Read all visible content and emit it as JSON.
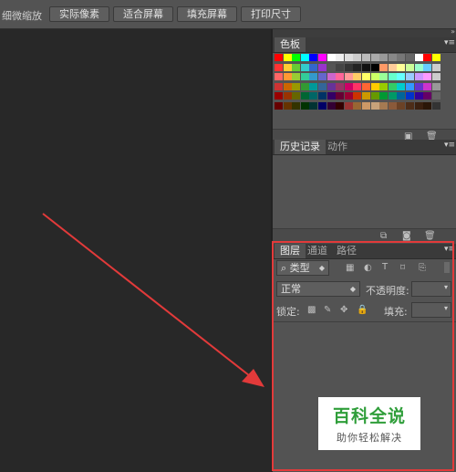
{
  "options_bar": {
    "scrubby_zoom_label": "细微缩放",
    "buttons": [
      "实际像素",
      "适合屏幕",
      "填充屏幕",
      "打印尺寸"
    ]
  },
  "swatches_panel": {
    "tab": "色板",
    "colors": [
      "#ff0000",
      "#ffff00",
      "#00ff00",
      "#00ffff",
      "#0000ff",
      "#ff00ff",
      "#ffffff",
      "#eeeeee",
      "#dddddd",
      "#cccccc",
      "#bbbbbb",
      "#aaaaaa",
      "#999999",
      "#888888",
      "#777777",
      "#666666",
      "#ffffff",
      "#ff0000",
      "#ffff00",
      "#ff3333",
      "#ffcc33",
      "#66cc33",
      "#33cccc",
      "#3366cc",
      "#9933cc",
      "#555555",
      "#444444",
      "#333333",
      "#222222",
      "#111111",
      "#000000",
      "#ff9966",
      "#ffcc99",
      "#ffff99",
      "#ccff99",
      "#99ffcc",
      "#66ccff",
      "#cccccc",
      "#ff6666",
      "#ff9933",
      "#99cc33",
      "#33cc99",
      "#3399cc",
      "#6666cc",
      "#cc66cc",
      "#ff6699",
      "#ff9999",
      "#ffcc66",
      "#ffff66",
      "#ccff66",
      "#99ff99",
      "#66ffcc",
      "#66ffff",
      "#99ccff",
      "#cc99ff",
      "#ff99ff",
      "#cccccc",
      "#cc3333",
      "#cc6600",
      "#999900",
      "#339933",
      "#009999",
      "#336699",
      "#663399",
      "#993366",
      "#cc0066",
      "#ff3366",
      "#ff6633",
      "#ffcc00",
      "#99cc00",
      "#33cc66",
      "#00cccc",
      "#3399ff",
      "#6633cc",
      "#cc33cc",
      "#999999",
      "#990000",
      "#993300",
      "#666600",
      "#006633",
      "#006666",
      "#003366",
      "#330066",
      "#660033",
      "#990033",
      "#cc3300",
      "#cc9900",
      "#669900",
      "#009933",
      "#009966",
      "#006699",
      "#0033cc",
      "#330099",
      "#660066",
      "#666666",
      "#660000",
      "#663300",
      "#333300",
      "#003300",
      "#003333",
      "#000066",
      "#330033",
      "#330000",
      "#993333",
      "#996633",
      "#cc9966",
      "#c8a27a",
      "#a57a52",
      "#8a5a3a",
      "#6b4226",
      "#4d2d18",
      "#3a2010",
      "#2a1608",
      "#333333"
    ]
  },
  "history_panel": {
    "tabs": [
      "历史记录",
      "动作"
    ]
  },
  "layers_panel": {
    "tabs": [
      "图层",
      "通道",
      "路径"
    ],
    "filter_kind": "类型",
    "blend_mode": "正常",
    "opacity_label": "不透明度:",
    "lock_label": "锁定:",
    "fill_label": "填充:"
  },
  "watermark": {
    "title": "百科全说",
    "subtitle": "助你轻松解决"
  },
  "colors": {
    "annotation_red": "#e23a3a",
    "watermark_green": "#2f9e3a"
  },
  "icons": {
    "panel_menu": "panel-menu-icon",
    "collapse": "double-chevron-icon"
  }
}
